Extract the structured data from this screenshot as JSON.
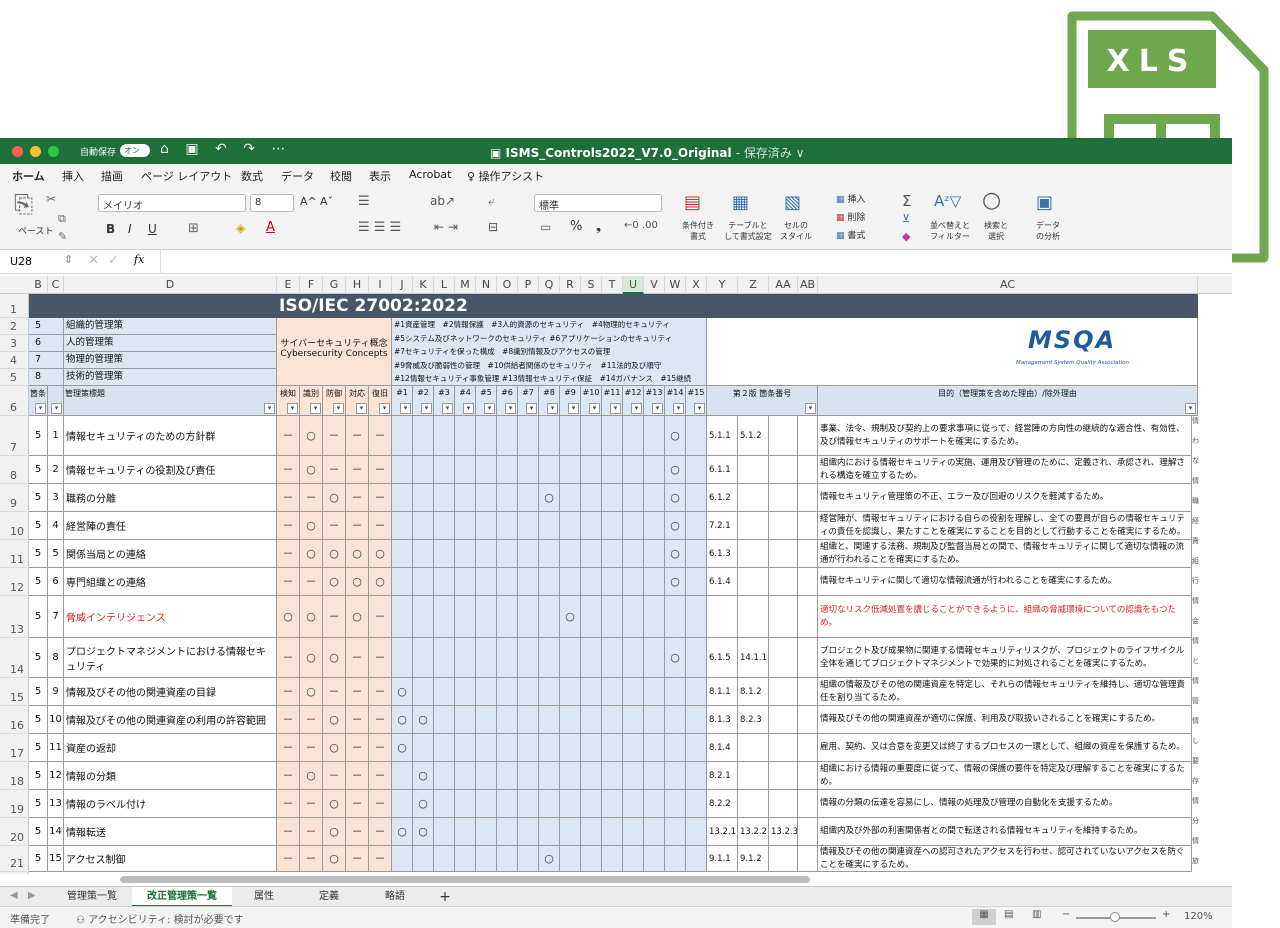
{
  "app": {
    "autosave_label": "自動保存",
    "autosave_state": "オン",
    "file_title": "ISMS_Controls2022_V7.0_Original",
    "save_state": "- 保存済み ∨"
  },
  "menu": [
    "ホーム",
    "挿入",
    "描画",
    "ページ レイアウト",
    "数式",
    "データ",
    "校閲",
    "表示",
    "Acrobat",
    "操作アシスト"
  ],
  "ribbon": {
    "paste": "ペースト",
    "font": "メイリオ",
    "font_size": "8",
    "number_format": "標準",
    "cond_format": "条件付き\n書式",
    "table_format": "テーブルと\nして書式設定",
    "cell_style": "セルの\nスタイル",
    "insert": "挿入",
    "delete": "削除",
    "format": "書式",
    "sort": "並べ替えと\nフィルター",
    "find": "検索と\n選択",
    "analyze": "データ\nの分析",
    "bold": "B",
    "italic": "I",
    "underline": "U",
    "percent": "%",
    "font_grow": "A^",
    "font_shrink": "Aˇ"
  },
  "formula": {
    "cell_ref": "U28",
    "fx": "fx",
    "value": ""
  },
  "col_headers": [
    "B",
    "C",
    "D",
    "E",
    "F",
    "G",
    "H",
    "I",
    "J",
    "K",
    "L",
    "M",
    "N",
    "O",
    "P",
    "Q",
    "R",
    "S",
    "T",
    "U",
    "V",
    "W",
    "X",
    "Y",
    "Z",
    "AA",
    "AB",
    "AC"
  ],
  "sheet_title": "ISO/IEC 27002:2022",
  "categories": [
    {
      "num": "5",
      "label": "組織的管理策"
    },
    {
      "num": "6",
      "label": "人的管理策"
    },
    {
      "num": "7",
      "label": "物理的管理策"
    },
    {
      "num": "8",
      "label": "技術的管理策"
    }
  ],
  "cyber_concepts": "サイバーセキュリティ概念\nCybersecurity Concepts",
  "tags_legend": [
    "#1資産管理　#2情報保護　#3人的資源のセキュリティ　#4物理的セキュリティ",
    "#5システム及びネットワークのセキュリティ #6アプリケーションのセキュリティ",
    "#7セキュリティを保った構成　#8識別情報及びアクセスの管理",
    "#9脅威及び脆弱性の管理　#10供給者関係のセキュリティ　#11法的及び順守",
    "#12情報セキュリティ事象管理 #13情報セキュリティ保証　#14ガバナンス　#15継続"
  ],
  "logo": {
    "main": "MSQA",
    "sub": "Management System Quality Association"
  },
  "header_row": {
    "clause": "箇条",
    "title": "管理策標題",
    "concepts": [
      "検知",
      "識別",
      "防御",
      "対応",
      "復旧"
    ],
    "tags": [
      "#1",
      "#2",
      "#3",
      "#4",
      "#5",
      "#6",
      "#7",
      "#8",
      "#9",
      "#10",
      "#11",
      "#12",
      "#13",
      "#14",
      "#15"
    ],
    "old_clause": "第２版 箇条番号",
    "purpose": "目的（管理策を含めた理由）/除外理由"
  },
  "row_numbers": [
    "1",
    "2",
    "3",
    "4",
    "5",
    "6",
    "7",
    "8",
    "9",
    "10",
    "11",
    "12",
    "13",
    "14",
    "15",
    "16",
    "17",
    "18",
    "19",
    "20",
    "21"
  ],
  "rows": [
    {
      "a": "5",
      "b": "1",
      "title": "情報セキュリティのための方針群",
      "c": [
        "－",
        "○",
        "－",
        "－",
        "－"
      ],
      "t": [
        14
      ],
      "old": [
        "5.1.1",
        "5.1.2",
        ""
      ],
      "purpose": "事業、法令、規制及び契約上の要求事項に従って、経営陣の方向性の継続的な適合性、有効性、及び情報セキュリティのサポートを確実にするため。",
      "red": false
    },
    {
      "a": "5",
      "b": "2",
      "title": "情報セキュリティの役割及び責任",
      "c": [
        "－",
        "○",
        "－",
        "－",
        "－"
      ],
      "t": [
        14
      ],
      "old": [
        "6.1.1",
        "",
        ""
      ],
      "purpose": "組織内における情報セキュリティの実施、運用及び管理のために、定義され、承認され、理解される構造を確立するため。",
      "red": false
    },
    {
      "a": "5",
      "b": "3",
      "title": "職務の分離",
      "c": [
        "－",
        "－",
        "○",
        "－",
        "－"
      ],
      "t": [
        8,
        14
      ],
      "old": [
        "6.1.2",
        "",
        ""
      ],
      "purpose": "情報セキュリティ管理策の不正、エラー及び回避のリスクを軽減するため。",
      "red": false
    },
    {
      "a": "5",
      "b": "4",
      "title": "経営陣の責任",
      "c": [
        "－",
        "○",
        "－",
        "－",
        "－"
      ],
      "t": [
        14
      ],
      "old": [
        "7.2.1",
        "",
        ""
      ],
      "purpose": "経営陣が、情報セキュリティにおける自らの役割を理解し、全ての要員が自らの情報セキュリティの責任を認識し、果たすことを確実にすることを目的として行動することを確実にするため。",
      "red": false
    },
    {
      "a": "5",
      "b": "5",
      "title": "関係当局との連絡",
      "c": [
        "－",
        "○",
        "○",
        "○",
        "○"
      ],
      "t": [
        14
      ],
      "old": [
        "6.1.3",
        "",
        ""
      ],
      "purpose": "組織と、関連する法務、規制及び監督当局との間で、情報セキュリティに関して適切な情報の流通が行われることを確実にするため。",
      "red": false
    },
    {
      "a": "5",
      "b": "6",
      "title": "専門組織との連絡",
      "c": [
        "－",
        "－",
        "○",
        "○",
        "○"
      ],
      "t": [
        14
      ],
      "old": [
        "6.1.4",
        "",
        ""
      ],
      "purpose": "情報セキュリティに関して適切な情報流通が行われることを確実にするため。",
      "red": false
    },
    {
      "a": "5",
      "b": "7",
      "title": "脅威インテリジェンス",
      "c": [
        "○",
        "○",
        "－",
        "○",
        "－"
      ],
      "t": [
        9
      ],
      "old": [
        "",
        "",
        ""
      ],
      "purpose": "適切なリスク低減処置を講じることができるように、組織の脅威環境についての認識をもつため。",
      "red": true
    },
    {
      "a": "5",
      "b": "8",
      "title": "プロジェクトマネジメントにおける情報セキュリティ",
      "c": [
        "－",
        "○",
        "○",
        "－",
        "－"
      ],
      "t": [
        14
      ],
      "old": [
        "6.1.5",
        "14.1.1",
        ""
      ],
      "purpose": "プロジェクト及び成果物に関連する情報セキュリティリスクが、プロジェクトのライフサイクル全体を通じてプロジェクトマネジメントで効果的に対処されることを確実にするため。",
      "red": false
    },
    {
      "a": "5",
      "b": "9",
      "title": "情報及びその他の関連資産の目録",
      "c": [
        "－",
        "○",
        "－",
        "－",
        "－"
      ],
      "t": [
        1
      ],
      "old": [
        "8.1.1",
        "8.1.2",
        ""
      ],
      "purpose": "組織の情報及びその他の関連資産を特定し、それらの情報セキュリティを維持し、適切な管理責任を割り当てるため。",
      "red": false
    },
    {
      "a": "5",
      "b": "10",
      "title": "情報及びその他の関連資産の利用の許容範囲",
      "c": [
        "－",
        "－",
        "○",
        "－",
        "－"
      ],
      "t": [
        1,
        2
      ],
      "old": [
        "8.1.3",
        "8.2.3",
        ""
      ],
      "purpose": "情報及びその他の関連資産が適切に保護、利用及び取扱いされることを確実にするため。",
      "red": false
    },
    {
      "a": "5",
      "b": "11",
      "title": "資産の返却",
      "c": [
        "－",
        "－",
        "○",
        "－",
        "－"
      ],
      "t": [
        1
      ],
      "old": [
        "8.1.4",
        "",
        ""
      ],
      "purpose": "雇用、契約、又は合意を変更又は終了するプロセスの一環として、組織の資産を保護するため。",
      "red": false
    },
    {
      "a": "5",
      "b": "12",
      "title": "情報の分類",
      "c": [
        "－",
        "○",
        "－",
        "－",
        "－"
      ],
      "t": [
        2
      ],
      "old": [
        "8.2.1",
        "",
        ""
      ],
      "purpose": "組織における情報の重要度に従って、情報の保護の要件を特定及び理解することを確実にするため。",
      "red": false
    },
    {
      "a": "5",
      "b": "13",
      "title": "情報のラベル付け",
      "c": [
        "－",
        "－",
        "○",
        "－",
        "－"
      ],
      "t": [
        2
      ],
      "old": [
        "8.2.2",
        "",
        ""
      ],
      "purpose": "情報の分類の伝達を容易にし、情報の処理及び管理の自動化を支援するため。",
      "red": false
    },
    {
      "a": "5",
      "b": "14",
      "title": "情報転送",
      "c": [
        "－",
        "－",
        "○",
        "－",
        "－"
      ],
      "t": [
        1,
        2
      ],
      "old": [
        "13.2.1",
        "13.2.2",
        "13.2.3"
      ],
      "purpose": "組織内及び外部の利害関係者との間で転送される情報セキュリティを維持するため。",
      "red": false
    },
    {
      "a": "5",
      "b": "15",
      "title": "アクセス制御",
      "c": [
        "－",
        "－",
        "○",
        "－",
        "－"
      ],
      "t": [
        8
      ],
      "old": [
        "9.1.1",
        "9.1.2",
        ""
      ],
      "purpose": "情報及びその他の関連資産への認可されたアクセスを行わせ、認可されていないアクセスを防ぐことを確実にするため。",
      "red": false
    }
  ],
  "right_edge": [
    "情",
    "わ",
    "な",
    "情",
    "職",
    "経",
    "責",
    "組",
    "行",
    "情",
    "会",
    "情",
    "と",
    "情",
    "管",
    "情",
    "し",
    "要",
    "存",
    "情",
    "分",
    "情",
    "旅",
    "情",
    "に",
    "情",
    "報"
  ],
  "sheet_tabs": [
    "管理策一覧",
    "改正管理策一覧",
    "属性",
    "定義",
    "略語",
    "+"
  ],
  "active_tab": 1,
  "status": {
    "ready": "準備完了",
    "accessibility": "アクセシビリティ: 検討が必要です",
    "zoom": "120%"
  },
  "icon": {
    "label": "XLS",
    "color": "#6fa74f"
  }
}
